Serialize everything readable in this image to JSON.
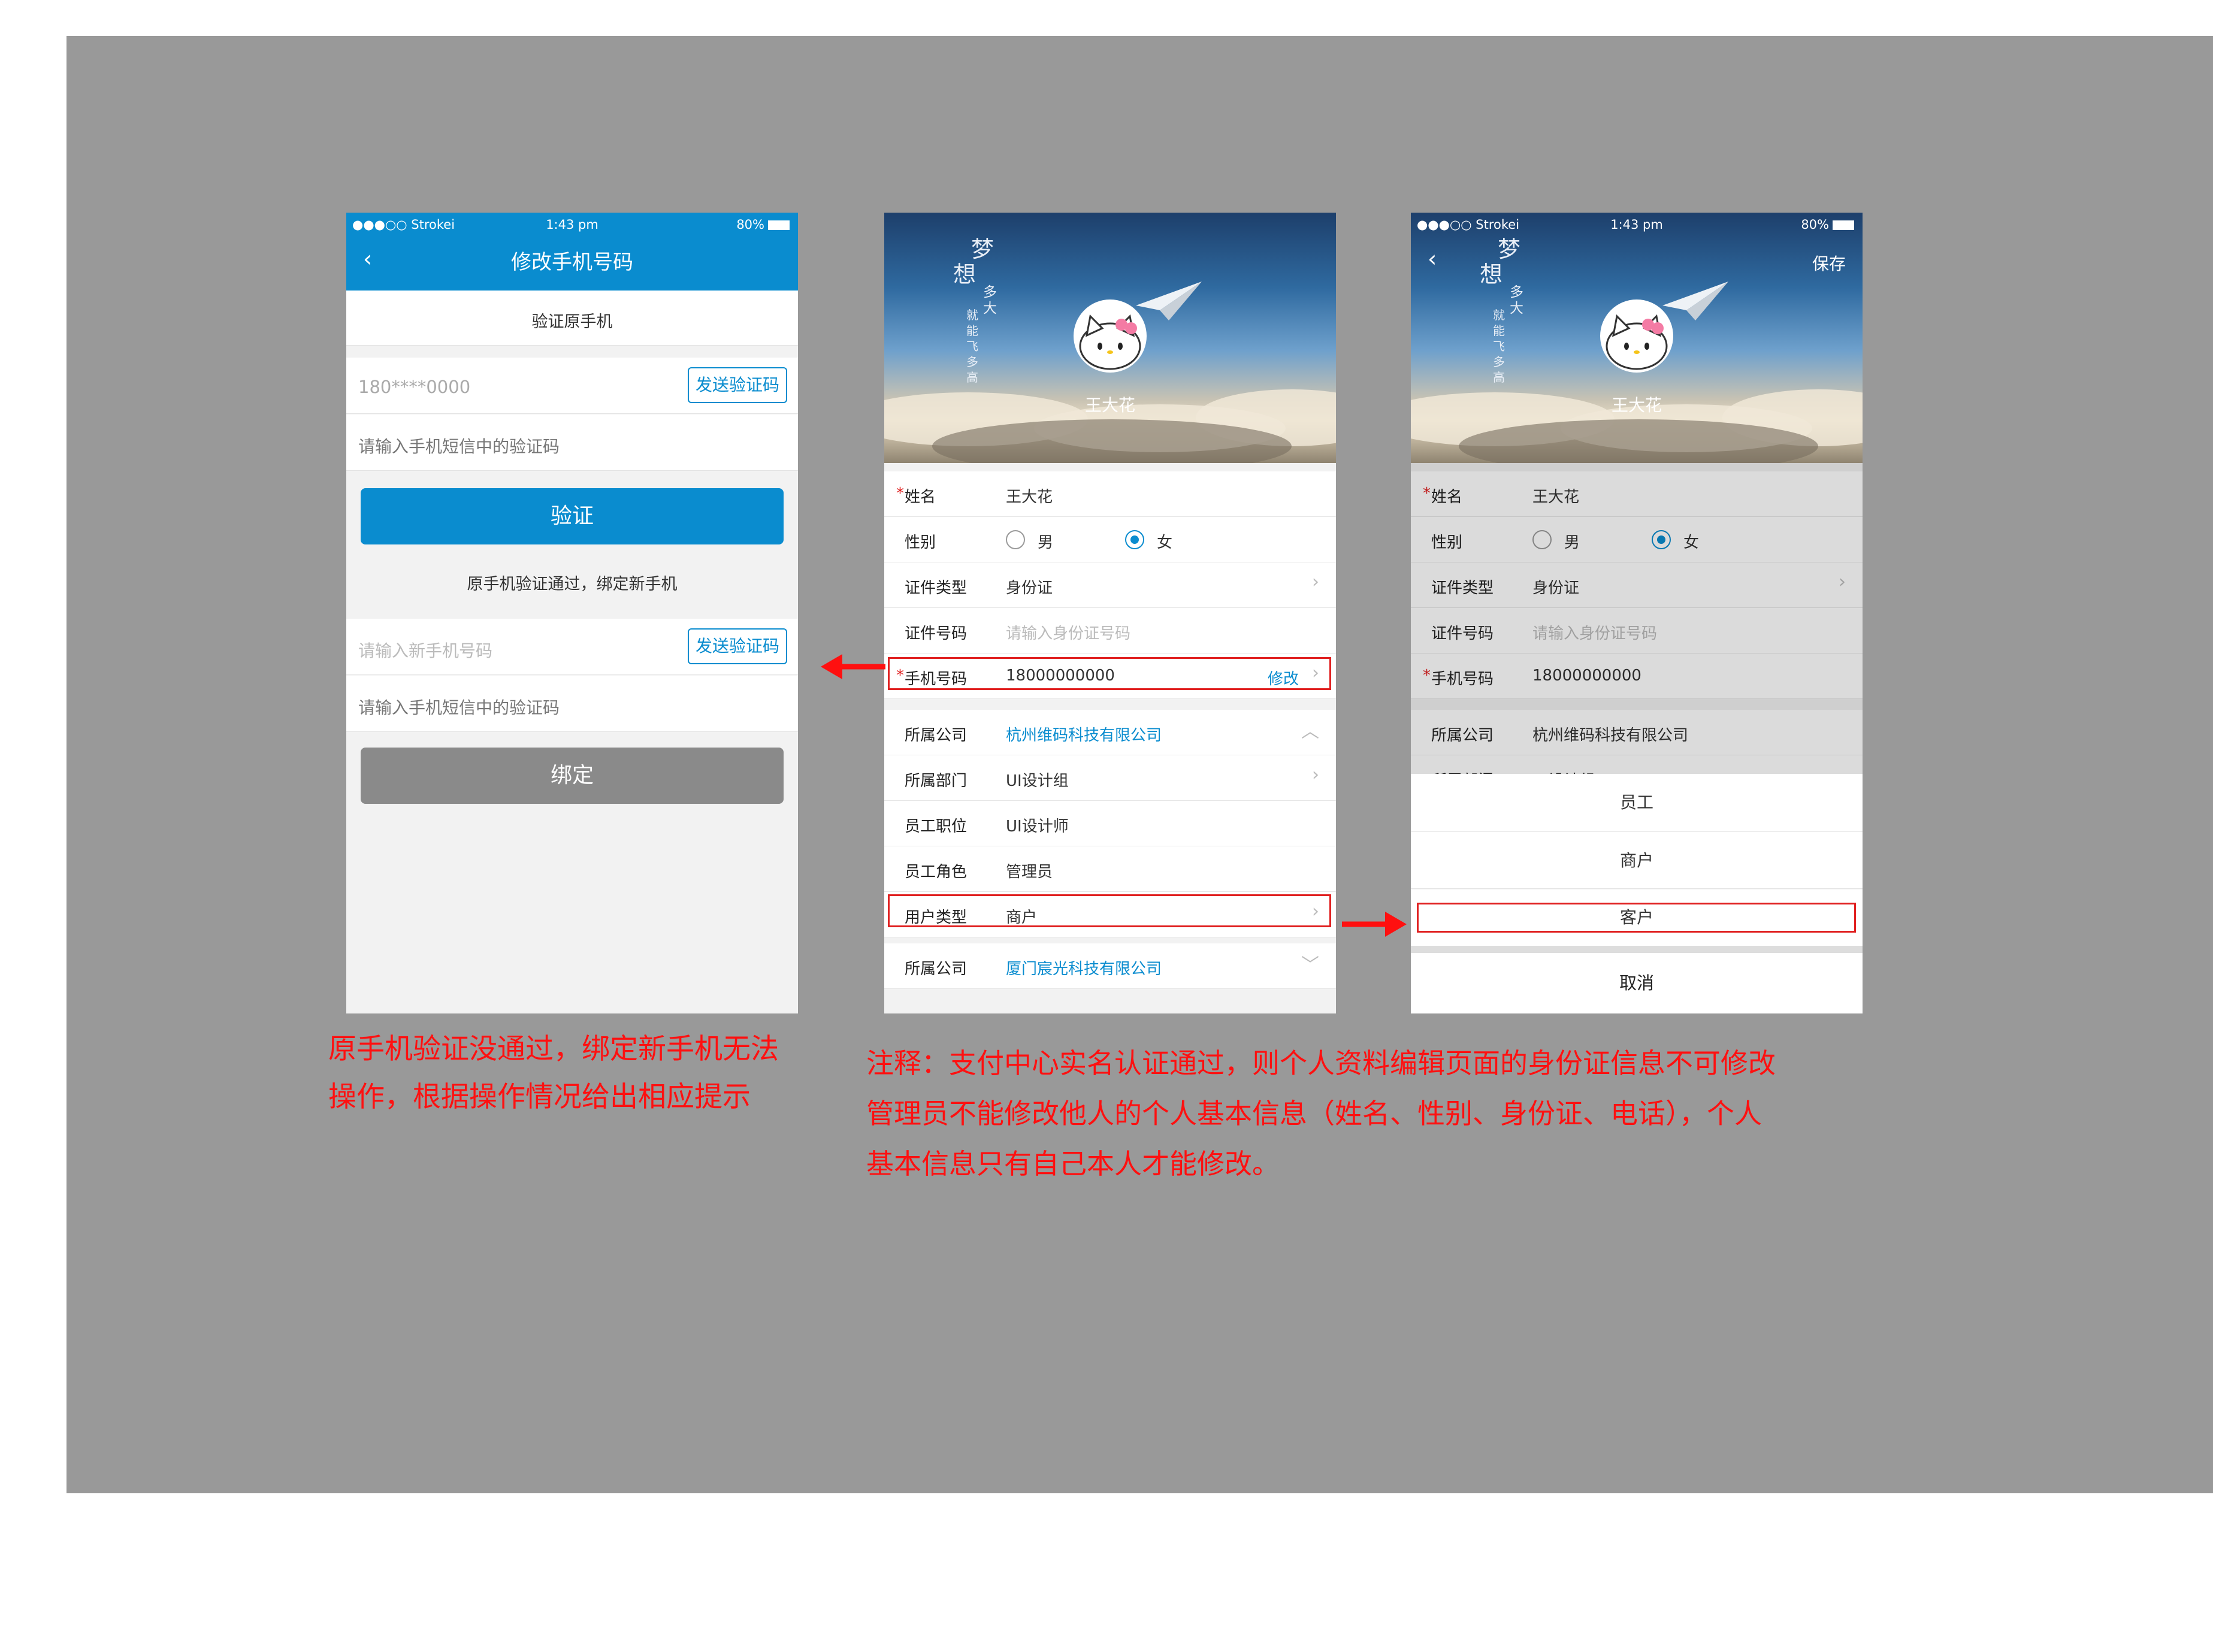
{
  "status": {
    "carrier": "●●●○○ Strokei",
    "time": "1:43 pm",
    "battery": "80%"
  },
  "screen1": {
    "title": "修改手机号码",
    "back_icon": "chevron-left-icon",
    "section_title": "验证原手机",
    "old_phone": "180****0000",
    "send_code": "发送验证码",
    "code_placeholder": "请输入手机短信中的验证码",
    "verify_button": "验证",
    "hint": "原手机验证通过，绑定新手机",
    "new_phone_placeholder": "请输入新手机号码",
    "send_code2": "发送验证码",
    "code_placeholder2": "请输入手机短信中的验证码",
    "bind_button": "绑定"
  },
  "profile": {
    "poem_big1": "梦",
    "poem_big2": "想",
    "poem_col1": "多大",
    "poem_col2": "就能飞多高",
    "user_name": "王大花",
    "save": "保存",
    "fields": {
      "name_label": "姓名",
      "name_value": "王大花",
      "gender_label": "性别",
      "male": "男",
      "female": "女",
      "id_type_label": "证件类型",
      "id_type_value": "身份证",
      "id_no_label": "证件号码",
      "id_no_placeholder": "请输入身份证号码",
      "phone_label": "手机号码",
      "phone_value": "18000000000",
      "phone_edit": "修改",
      "company_label": "所属公司",
      "company_value": "杭州维码科技有限公司",
      "dept_label": "所属部门",
      "dept_value": "UI设计组",
      "position_label": "员工职位",
      "position_value": "UI设计师",
      "role_label": "员工角色",
      "role_value": "管理员",
      "user_type_label": "用户类型",
      "user_type_value": "商户",
      "company2_label": "所属公司",
      "company2_value": "厦门宸光科技有限公司"
    }
  },
  "sheet": {
    "options": [
      "员工",
      "商户",
      "客户"
    ],
    "cancel": "取消"
  },
  "notes": {
    "left_line1": "原手机验证没通过，绑定新手机无法",
    "left_line2": "操作，根据操作情况给出相应提示",
    "right_line1": "注释：支付中心实名认证通过，则个人资料编辑页面的身份证信息不可修改",
    "right_line2": "管理员不能修改他人的个人基本信息（姓名、性别、身份证、电话），个人",
    "right_line3": "基本信息只有自己本人才能修改。"
  },
  "colors": {
    "accent": "#0a8ccf",
    "annotation": "#e02020",
    "background": "#999999"
  }
}
